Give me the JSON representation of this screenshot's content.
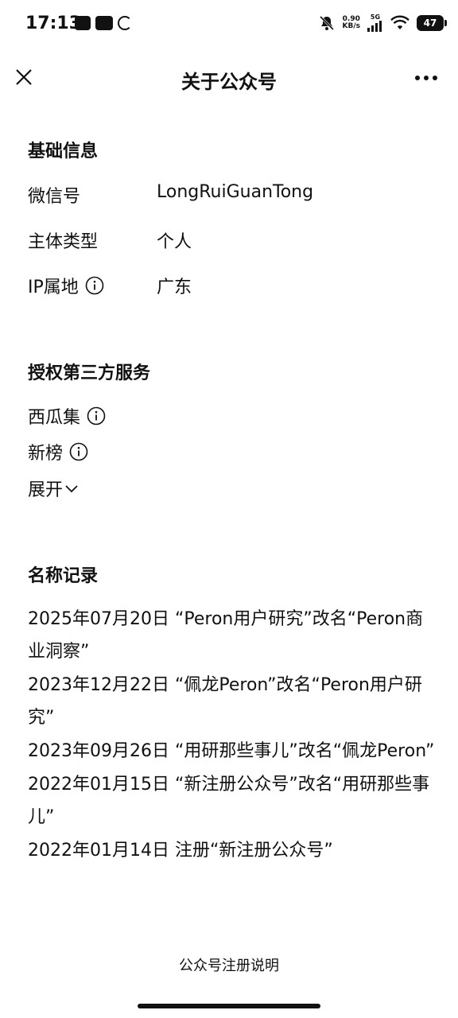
{
  "status_bar": {
    "time": "17:13",
    "net_speed_value": "0.90",
    "net_speed_unit": "KB/s",
    "signal_label": "5G",
    "battery_level": "47"
  },
  "header": {
    "title": "关于公众号"
  },
  "basic_info": {
    "section_title": "基础信息",
    "rows": [
      {
        "label": "微信号",
        "value": "LongRuiGuanTong"
      },
      {
        "label": "主体类型",
        "value": "个人"
      },
      {
        "label": "IP属地",
        "value": "广东"
      }
    ]
  },
  "third_party": {
    "section_title": "授权第三方服务",
    "services": [
      {
        "label": "西瓜集"
      },
      {
        "label": "新榜"
      }
    ],
    "expand_label": "展开"
  },
  "name_history": {
    "section_title": "名称记录",
    "records": [
      "2025年07月20日 “Peron用户研究”改名“Peron商业洞察”",
      "2023年12月22日 “佩龙Peron”改名“Peron用户研究”",
      "2023年09月26日 “用研那些事儿”改名“佩龙Peron”",
      "2022年01月15日 “新注册公众号”改名“用研那些事儿”",
      "2022年01月14日 注册“新注册公众号”"
    ]
  },
  "footer": {
    "link_label": "公众号注册说明"
  }
}
